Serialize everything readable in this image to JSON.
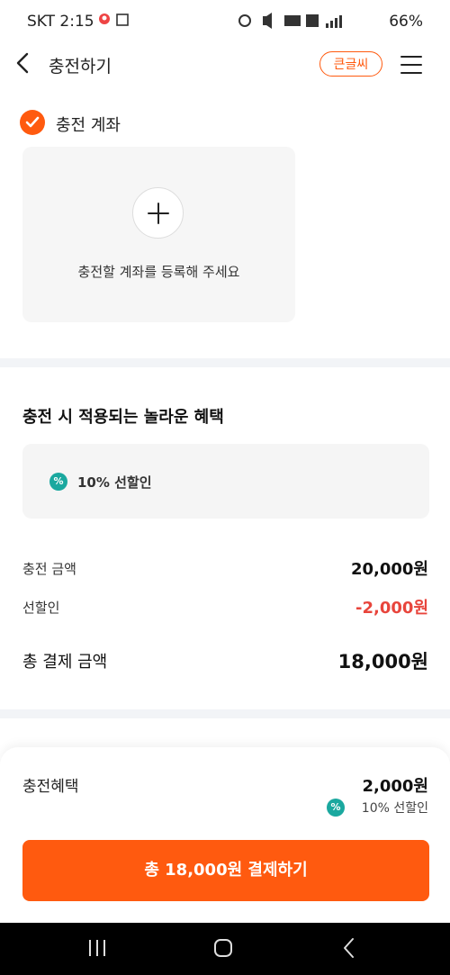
{
  "status_bar": {
    "carrier_time": "SKT 2:15",
    "battery": "66%",
    "icons": [
      "maps-icon",
      "image-icon",
      "alarm-icon",
      "mute-icon",
      "hd-voice-icon",
      "5g-icon",
      "signal-icon",
      "battery-icon"
    ]
  },
  "header": {
    "title": "충전하기",
    "big_text_label": "큰글씨"
  },
  "account": {
    "label": "충전 계좌",
    "add_text": "충전할 계좌를 등록해 주세요"
  },
  "benefits": {
    "title": "충전 시 적용되는 놀라운 혜택",
    "item": "10% 선할인",
    "icon_glyph": "%"
  },
  "summary": {
    "charge_label": "충전 금액",
    "charge_value": "20,000원",
    "discount_label": "선할인",
    "discount_value": "-2,000원",
    "total_label": "총 결제 금액",
    "total_value": "18,000원"
  },
  "sheet": {
    "label": "충전혜택",
    "value": "2,000원",
    "sub": "10% 선할인",
    "pay_button": "총 18,000원 결제하기"
  },
  "colors": {
    "accent": "#ff5a0f",
    "teal": "#1aa89f",
    "discount": "#e8453c"
  }
}
